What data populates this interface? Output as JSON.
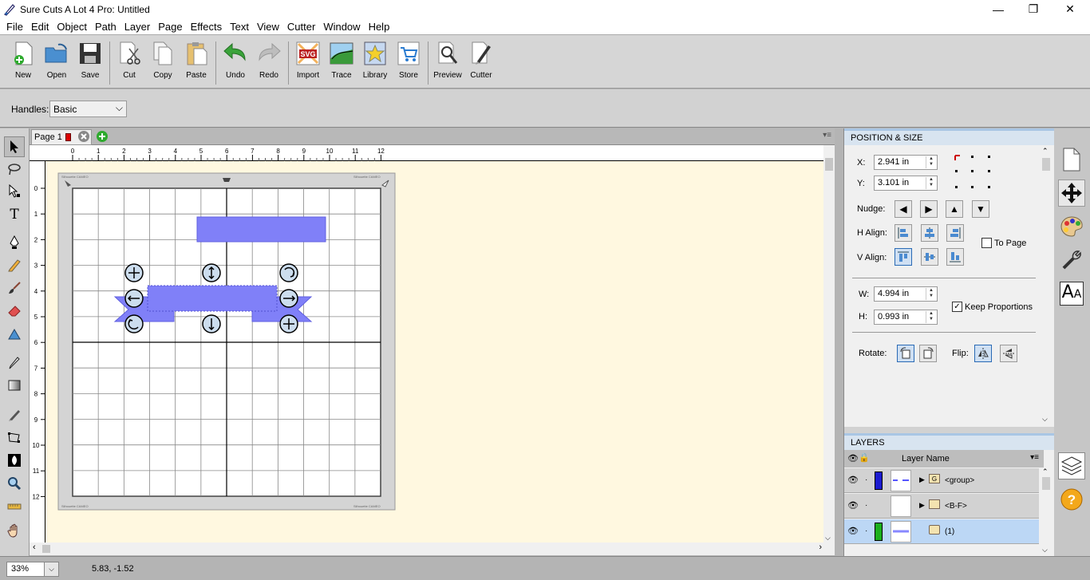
{
  "window": {
    "title": "Sure Cuts A Lot 4 Pro: Untitled",
    "minimize": "—",
    "maximize": "❐",
    "close": "✕"
  },
  "menu": [
    "File",
    "Edit",
    "Object",
    "Path",
    "Layer",
    "Page",
    "Effects",
    "Text",
    "View",
    "Cutter",
    "Window",
    "Help"
  ],
  "toolbar": {
    "new": "New",
    "open": "Open",
    "save": "Save",
    "cut": "Cut",
    "copy": "Copy",
    "paste": "Paste",
    "undo": "Undo",
    "redo": "Redo",
    "import": "Import",
    "trace": "Trace",
    "library": "Library",
    "store": "Store",
    "preview": "Preview",
    "cutter": "Cutter",
    "import_badge": "SVG"
  },
  "handles": {
    "label": "Handles:",
    "value": "Basic"
  },
  "page_tab": {
    "label": "Page 1"
  },
  "ruler": {
    "h_ticks": [
      "0",
      "1",
      "2",
      "3",
      "4",
      "5",
      "6",
      "7",
      "8",
      "9",
      "10",
      "11",
      "12"
    ],
    "v_ticks": [
      "0",
      "1",
      "2",
      "3",
      "4",
      "5",
      "6",
      "7",
      "8",
      "9",
      "10",
      "11",
      "12"
    ]
  },
  "mat": {
    "brand": "Silhouette CAMEO"
  },
  "position_size": {
    "header": "POSITION & SIZE",
    "x_label": "X:",
    "x_value": "2.941 in",
    "y_label": "Y:",
    "y_value": "3.101 in",
    "nudge_label": "Nudge:",
    "halign_label": "H Align:",
    "valign_label": "V Align:",
    "to_page_label": "To Page",
    "w_label": "W:",
    "w_value": "4.994 in",
    "h_label": "H:",
    "h_value": "0.993 in",
    "keep_proportions_label": "Keep Proportions",
    "rotate_label": "Rotate:",
    "flip_label": "Flip:"
  },
  "layers": {
    "header": "LAYERS",
    "column": "Layer Name",
    "rows": [
      {
        "name": "<group>",
        "color": "#1b1bd0",
        "badge": "G"
      },
      {
        "name": "<B-F>",
        "color": "",
        "badge": ""
      },
      {
        "name": "(1)",
        "color": "#1bb01b",
        "badge": ""
      }
    ]
  },
  "status": {
    "zoom": "33%",
    "coords": "5.83, -1.52"
  },
  "colors": {
    "shape_fill": "#8080f8",
    "workspace_bg": "#fff8e0",
    "panel_header": "#d8e4f0",
    "accent": "#2a6ab5"
  }
}
